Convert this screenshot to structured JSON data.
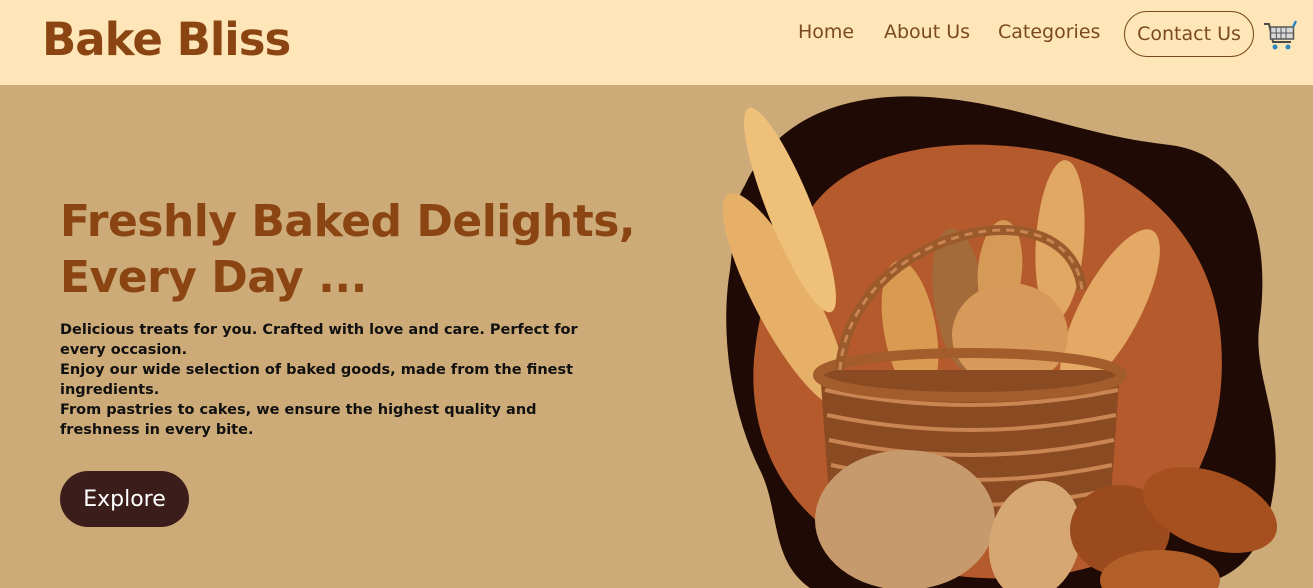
{
  "brand": {
    "name": "Bake Bliss"
  },
  "nav": {
    "home": "Home",
    "about": "About Us",
    "categories": "Categories",
    "contact": "Contact Us"
  },
  "hero": {
    "title_line1": "Freshly Baked Delights,",
    "title_line2": "Every Day ...",
    "paragraphs": [
      "Delicious treats for you. Crafted with love and care. Perfect for every occasion.",
      "Enjoy our wide selection of baked goods, made from the finest ingredients.",
      "From pastries to cakes, we ensure the highest quality and freshness in every bite."
    ],
    "cta": "Explore"
  },
  "icons": {
    "cart": "shopping-cart-icon"
  },
  "colors": {
    "nav_bg": "#ffe6b8",
    "page_bg": "#cdab78",
    "brand": "#8b4513",
    "button_bg": "#3b1e1b",
    "blob_dark": "#1f0a05",
    "blob_orange": "#b55a2c"
  }
}
